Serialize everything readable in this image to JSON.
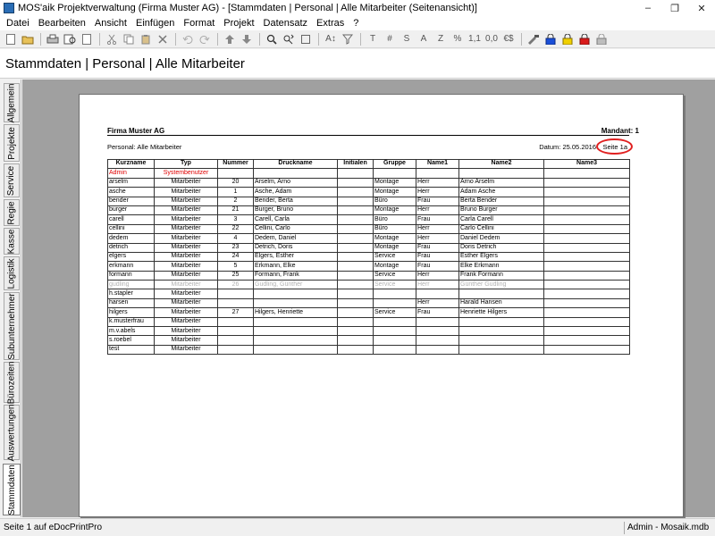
{
  "window": {
    "title": "MOS'aik Projektverwaltung (Firma Muster AG) - [Stammdaten | Personal | Alle Mitarbeiter (Seitenansicht)]",
    "controls": [
      "–",
      "❐",
      "✕"
    ]
  },
  "menu": [
    "Datei",
    "Bearbeiten",
    "Ansicht",
    "Einfügen",
    "Format",
    "Projekt",
    "Datensatz",
    "Extras",
    "?"
  ],
  "toolbar": {
    "glyphs": [
      "A↕",
      "T",
      "#",
      "S",
      "A",
      "Z",
      "%",
      "1,1",
      "0,0",
      "€$"
    ],
    "icon_colors": [
      "#1a4fd8",
      "#f0d000",
      "#d91c1c",
      "#9a9a9a"
    ]
  },
  "heading": "Stammdaten | Personal | Alle Mitarbeiter",
  "tabs": [
    "Allgemein",
    "Projekte",
    "Service",
    "Regie",
    "Kasse",
    "Logistik",
    "Subunternehmer",
    "Bürozeiten",
    "Auswertungen",
    "Stammdaten"
  ],
  "report": {
    "company": "Firma Muster AG",
    "mandant": "Mandant: 1",
    "subtitle": "Personal: Alle Mitarbeiter",
    "datum": "Datum: 25.05.2016",
    "seite": "Seite 1a",
    "columns": [
      "Kurzname",
      "Typ",
      "Nummer",
      "Druckname",
      "Initialen",
      "Gruppe",
      "Name1",
      "Name2",
      "Name3"
    ],
    "rows": [
      [
        "Admin",
        "Systembenutzer",
        "",
        "",
        "",
        "",
        "",
        "",
        ""
      ],
      [
        "arselm",
        "Mitarbeiter",
        "20",
        "Arselm, Arno",
        "",
        "Montage",
        "Herr",
        "Arno Arselm",
        ""
      ],
      [
        "asche",
        "Mitarbeiter",
        "1",
        "Asche, Adam",
        "",
        "Montage",
        "Herr",
        "Adam Asche",
        ""
      ],
      [
        "bender",
        "Mitarbeiter",
        "2",
        "Bender, Berta",
        "",
        "Büro",
        "Frau",
        "Berta Bender",
        ""
      ],
      [
        "burger",
        "Mitarbeiter",
        "21",
        "Burger, Bruno",
        "",
        "Montage",
        "Herr",
        "Bruno Burger",
        ""
      ],
      [
        "carell",
        "Mitarbeiter",
        "3",
        "Carell, Carla",
        "",
        "Büro",
        "Frau",
        "Carla Carell",
        ""
      ],
      [
        "cellini",
        "Mitarbeiter",
        "22",
        "Cellini, Carlo",
        "",
        "Büro",
        "Herr",
        "Carlo Cellini",
        ""
      ],
      [
        "dedem",
        "Mitarbeiter",
        "4",
        "Dedem, Daniel",
        "",
        "Montage",
        "Herr",
        "Daniel Dedem",
        ""
      ],
      [
        "detrich",
        "Mitarbeiter",
        "23",
        "Detrich, Doris",
        "",
        "Montage",
        "Frau",
        "Doris Detrich",
        ""
      ],
      [
        "elgers",
        "Mitarbeiter",
        "24",
        "Elgers, Esther",
        "",
        "Service",
        "Frau",
        "Esther Elgers",
        ""
      ],
      [
        "erkmann",
        "Mitarbeiter",
        "5",
        "Erkmann, Elke",
        "",
        "Montage",
        "Frau",
        "Elke Erkmann",
        ""
      ],
      [
        "formann",
        "Mitarbeiter",
        "25",
        "Formann, Frank",
        "",
        "Service",
        "Herr",
        "Frank Formann",
        ""
      ],
      [
        "gudling",
        "Mitarbeiter",
        "26",
        "Gudling, Günther",
        "",
        "Service",
        "Herr",
        "Günther Gudling",
        ""
      ],
      [
        "h.stapler",
        "Mitarbeiter",
        "",
        "",
        "",
        "",
        "",
        "",
        ""
      ],
      [
        "harsen",
        "Mitarbeiter",
        "",
        "",
        "",
        "",
        "Herr",
        "Harald Hansen",
        ""
      ],
      [
        "hilgers",
        "Mitarbeiter",
        "27",
        "Hilgers, Henriette",
        "",
        "Service",
        "Frau",
        "Henriette Hilgers",
        ""
      ],
      [
        "k.musterfrau",
        "Mitarbeiter",
        "",
        "",
        "",
        "",
        "",
        "",
        ""
      ],
      [
        "m.v.abels",
        "Mitarbeiter",
        "",
        "",
        "",
        "",
        "",
        "",
        ""
      ],
      [
        "s.roebel",
        "Mitarbeiter",
        "",
        "",
        "",
        "",
        "",
        "",
        ""
      ],
      [
        "test",
        "Mitarbeiter",
        "",
        "",
        "",
        "",
        "",
        "",
        ""
      ]
    ],
    "highlight_colors": {
      "system_row": "#e00000",
      "inactive_row": "#b2b2b2",
      "page_circle": "#e02020"
    }
  },
  "status": {
    "left": "Seite 1 auf eDocPrintPro",
    "user": "Admin - Mosaik.mdb"
  }
}
